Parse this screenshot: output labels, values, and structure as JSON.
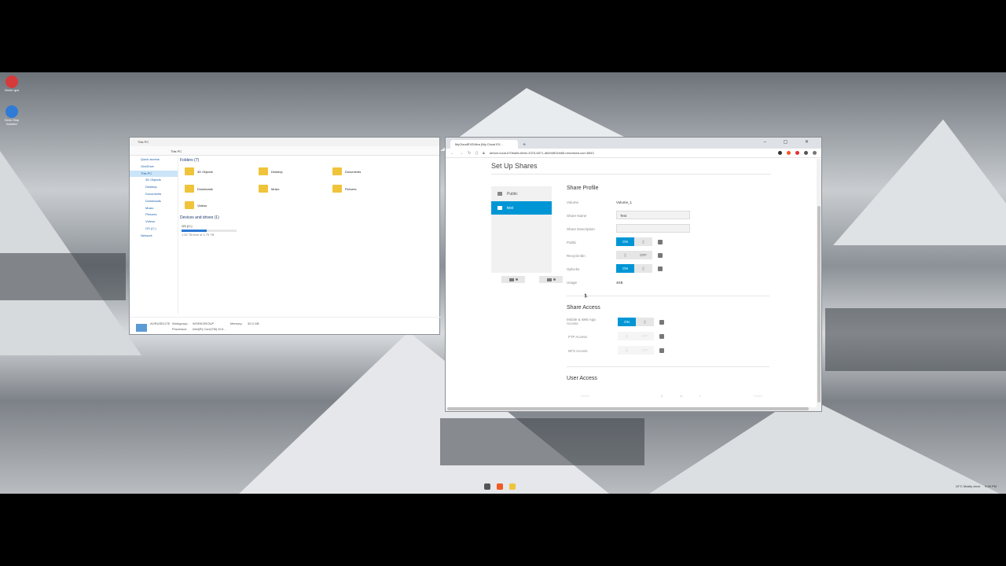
{
  "desktop": {
    "icons": [
      {
        "label": "Nowe ąpa"
      },
      {
        "label": "Desk Stop Assister"
      }
    ]
  },
  "explorer": {
    "title": "This PC",
    "address": "This PC",
    "nav": [
      {
        "label": "Quick access"
      },
      {
        "label": "OneDrive"
      },
      {
        "label": "This PC"
      },
      {
        "label": "3D Objects"
      },
      {
        "label": "Desktop"
      },
      {
        "label": "Documents"
      },
      {
        "label": "Downloads"
      },
      {
        "label": "Music"
      },
      {
        "label": "Pictures"
      },
      {
        "label": "Videos"
      },
      {
        "label": "OS (C:)"
      },
      {
        "label": "Network"
      }
    ],
    "folders_header": "Folders (7)",
    "folders": [
      {
        "label": "3D Objects"
      },
      {
        "label": "Desktop"
      },
      {
        "label": "Documents"
      },
      {
        "label": "Downloads"
      },
      {
        "label": "Music"
      },
      {
        "label": "Pictures"
      },
      {
        "label": "Videos"
      }
    ],
    "drives_header": "Devices and drives (1)",
    "drive": {
      "label": "OS (C:)",
      "free": "1.52 TB free of 2.79 TB",
      "used_fraction": 0.46
    },
    "details": {
      "computer": "AORUSELITE",
      "workgroup_label": "Workgroup:",
      "workgroup": "WORKGROUP",
      "memory_label": "Memory:",
      "memory": "32.0 GB",
      "processor_label": "Processor:",
      "processor": "Intel(R) Core(TM) i9-9..."
    }
  },
  "browser": {
    "tab_title": "MyCloudEX2Ultra (My Cloud EX...",
    "new_tab": "+",
    "url": "device-local-670ba6b-bbbe-4375-b571-d649df01bb65.remotewd.com:8543",
    "page": {
      "title": "Set Up Shares",
      "shares": [
        {
          "label": "Public"
        },
        {
          "label": "test"
        }
      ],
      "profile_title": "Share Profile",
      "volume_label": "Volume",
      "volume_value": "Volume_1",
      "share_name_label": "Share Name",
      "share_name_value": "Test",
      "share_desc_label": "Share Description",
      "share_desc_value": "",
      "public_label": "Public",
      "recycle_label": "Recycle Bin",
      "oplocks_label": "Oplocks",
      "usage_label": "Usage",
      "usage_value": "4KB",
      "on_text": "ON",
      "off_text": "OFF",
      "grip_text": "|||",
      "access_title": "Share Access",
      "mobile_label": "Mobile & Web App Access",
      "ftp_label": "FTP Access",
      "nfs_label": "NFS Access",
      "user_access_title": "User Access",
      "user_row_name": "admin",
      "user_row_perm": "Public"
    }
  },
  "taskbar": {
    "weather": "10°C  Mostly clear",
    "time": "9:48 PM"
  }
}
